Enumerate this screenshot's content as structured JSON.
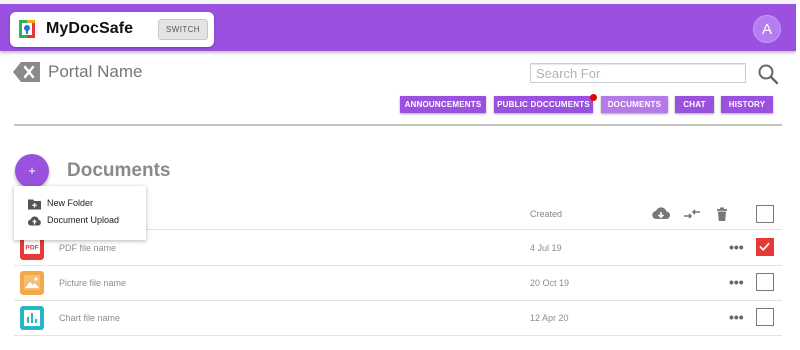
{
  "header": {
    "brand_name": "MyDocSafe",
    "switch_label": "SWITCH",
    "avatar_letter": "A",
    "bar_color": "#9b51e0"
  },
  "portal": {
    "name": "Portal Name",
    "search_placeholder": "Search For"
  },
  "nav": {
    "tabs": [
      {
        "label": "ANNOUNCEMENTS",
        "active": false
      },
      {
        "label": "PUBLIC DOCCUMENTS",
        "active": false,
        "notification": true
      },
      {
        "label": "DOCUMENTS",
        "active": true
      },
      {
        "label": "CHAT",
        "active": false
      },
      {
        "label": "HISTORY",
        "active": false
      }
    ]
  },
  "documents": {
    "title": "Documents",
    "add_button_label": "+",
    "menu": [
      {
        "label": "New Folder",
        "icon": "new-folder-icon"
      },
      {
        "label": "Document Upload",
        "icon": "cloud-upload-icon"
      }
    ],
    "columns": {
      "created": "Created"
    },
    "header_icons": [
      "cloud-download-icon",
      "move-icon",
      "trash-icon"
    ],
    "rows": [
      {
        "name": "PDF file name",
        "date": "4 Jul 19",
        "type": "pdf",
        "color": "#e53935",
        "checked": true
      },
      {
        "name": "Picture file name",
        "date": "20 Oct 19",
        "type": "picture",
        "color": "#f4a84a",
        "checked": false
      },
      {
        "name": "Chart file name",
        "date": "12 Apr 20",
        "type": "chart",
        "color": "#26b5c9",
        "checked": false
      }
    ],
    "more_label": "•••"
  },
  "colors": {
    "accent": "#9b51e0",
    "accent_light": "#b37ae8",
    "notification": "#e00000",
    "checked": "#e53935"
  }
}
